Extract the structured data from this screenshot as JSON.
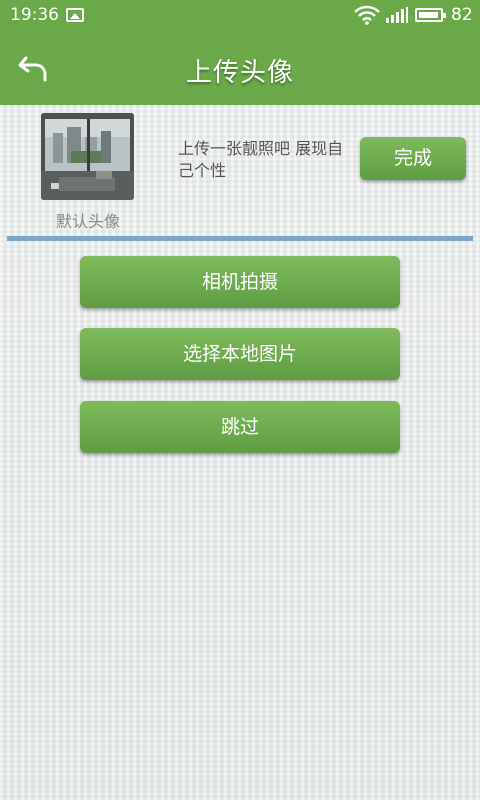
{
  "status_bar": {
    "time": "19:36",
    "battery": "82",
    "icons": [
      "image-icon",
      "wifi-icon",
      "signal-icon",
      "battery-icon"
    ]
  },
  "header": {
    "title": "上传头像",
    "back_icon": "back-arrow-icon"
  },
  "profile": {
    "avatar_caption": "默认头像",
    "hint": "上传一张靓照吧  展现自己个性",
    "done_label": "完成"
  },
  "actions": {
    "camera_label": "相机拍摄",
    "local_label": "选择本地图片",
    "skip_label": "跳过"
  },
  "colors": {
    "accent_green": "#6aa84a",
    "divider_blue": "#7fa6c4"
  }
}
